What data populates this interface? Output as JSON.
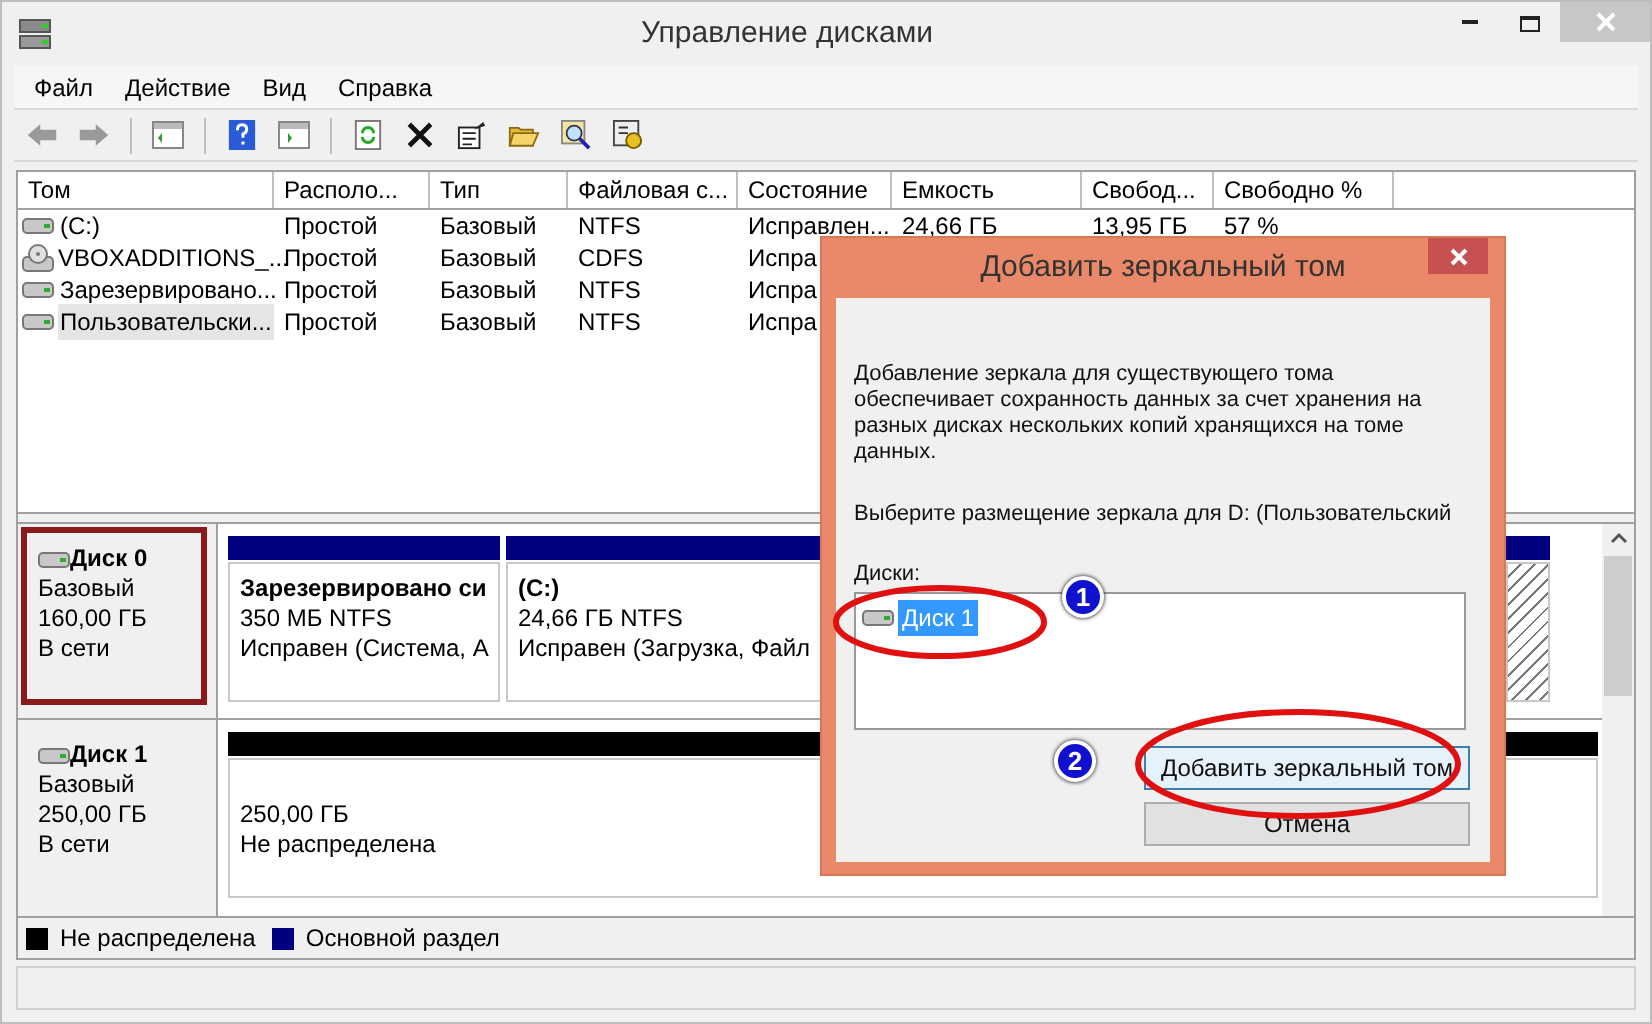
{
  "window": {
    "title": "Управление дисками"
  },
  "menu": [
    "Файл",
    "Действие",
    "Вид",
    "Справка"
  ],
  "volumes": {
    "columns": [
      "Том",
      "Располо...",
      "Тип",
      "Файловая с...",
      "Состояние",
      "Емкость",
      "Свобод...",
      "Свободно %"
    ],
    "rows": [
      {
        "kind": "disk",
        "selected": false,
        "cells": [
          "(C:)",
          "Простой",
          "Базовый",
          "NTFS",
          "Исправлен...",
          "24,66 ГБ",
          "13,95 ГБ",
          "57 %"
        ]
      },
      {
        "kind": "cd",
        "selected": false,
        "cells": [
          "VBOXADDITIONS_...",
          "Простой",
          "Базовый",
          "CDFS",
          "Испра"
        ]
      },
      {
        "kind": "disk",
        "selected": false,
        "cells": [
          "Зарезервировано...",
          "Простой",
          "Базовый",
          "NTFS",
          "Испра"
        ]
      },
      {
        "kind": "disk",
        "selected": true,
        "cells": [
          "Пользовательски...",
          "Простой",
          "Базовый",
          "NTFS",
          "Испра"
        ]
      }
    ]
  },
  "disks": [
    {
      "name": "Диск 0",
      "type": "Базовый",
      "size": "160,00 ГБ",
      "status": "В сети",
      "partitions": [
        {
          "kind": "primary",
          "selected": false,
          "lines": [
            "Зарезервировано си",
            "350 МБ NTFS",
            "Исправен (Система, А"
          ]
        },
        {
          "kind": "primary",
          "selected": false,
          "lines": [
            "(C:)",
            "24,66 ГБ NTFS",
            "Исправен (Загрузка, Файл"
          ]
        },
        {
          "kind": "primary",
          "selected": true
        }
      ]
    },
    {
      "name": "Диск 1",
      "type": "Базовый",
      "size": "250,00 ГБ",
      "status": "В сети",
      "partitions": [
        {
          "kind": "unallocated",
          "selected": false,
          "lines": [
            "250,00 ГБ",
            "Не распределена"
          ]
        }
      ]
    }
  ],
  "legend": [
    {
      "label": "Не распределена",
      "color": "#000000"
    },
    {
      "label": "Основной раздел",
      "color": "#000080"
    }
  ],
  "dialog": {
    "title": "Добавить зеркальный том",
    "description": "Добавление зеркала для существующего тома обеспечивает сохранность данных за счет хранения  на разных дисках нескольких копий хранящихся на томе данных.",
    "prompt": "Выберите размещение зеркала для D: (Пользовательский",
    "disks_label": "Диски:",
    "disks": [
      {
        "label": "Диск 1",
        "selected": true
      }
    ],
    "buttons": [
      {
        "label": "Добавить зеркальный том",
        "kind": "default"
      },
      {
        "label": "Отмена",
        "kind": "normal"
      }
    ]
  },
  "annotations": [
    {
      "label": "1"
    },
    {
      "label": "2"
    }
  ]
}
